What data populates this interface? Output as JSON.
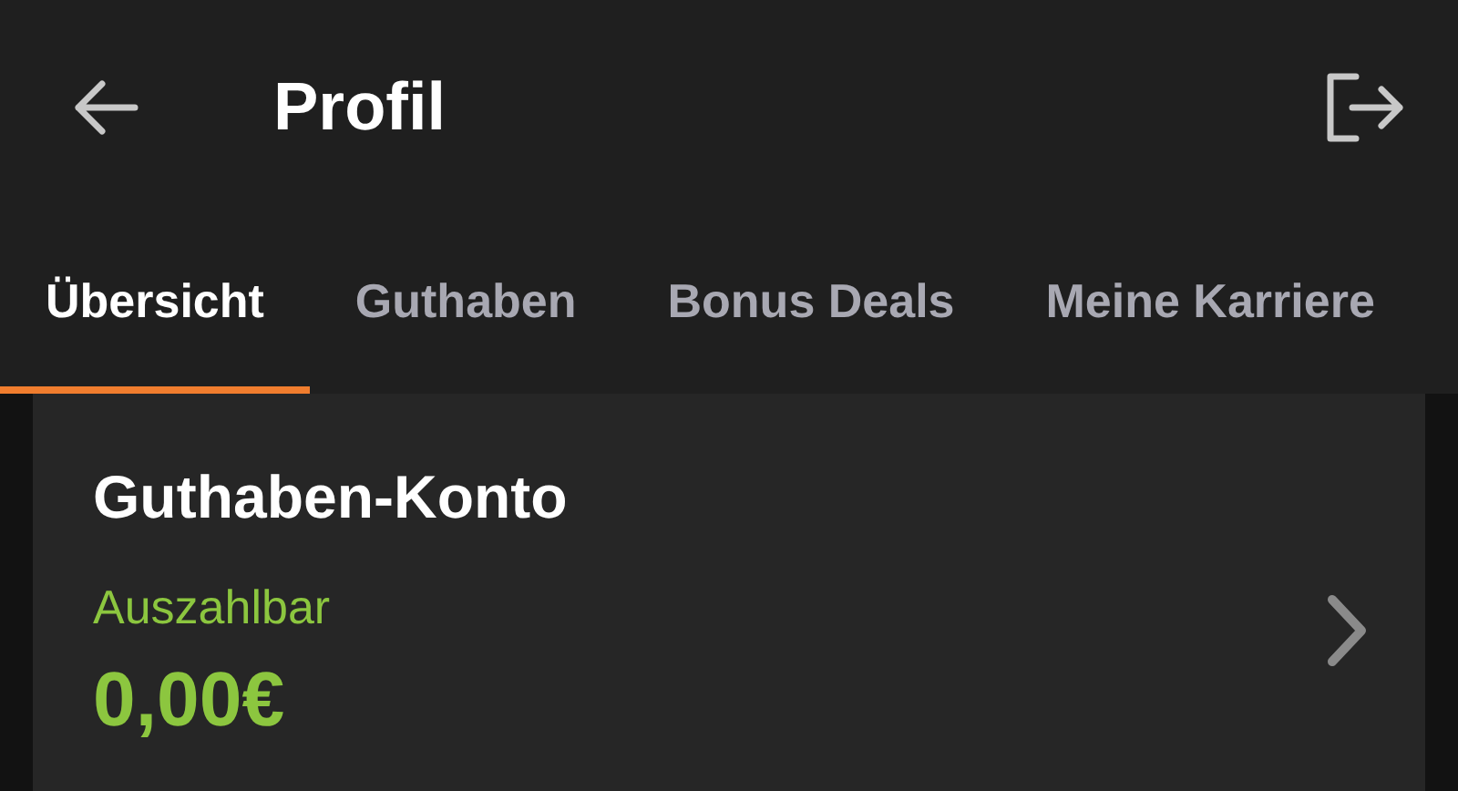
{
  "header": {
    "title": "Profil"
  },
  "tabs": [
    {
      "label": "Übersicht",
      "selected": true
    },
    {
      "label": "Guthaben",
      "selected": false
    },
    {
      "label": "Bonus Deals",
      "selected": false
    },
    {
      "label": "Meine Karriere",
      "selected": false
    }
  ],
  "card": {
    "title": "Guthaben-Konto",
    "label": "Auszahlbar",
    "amount": "0,00€"
  }
}
